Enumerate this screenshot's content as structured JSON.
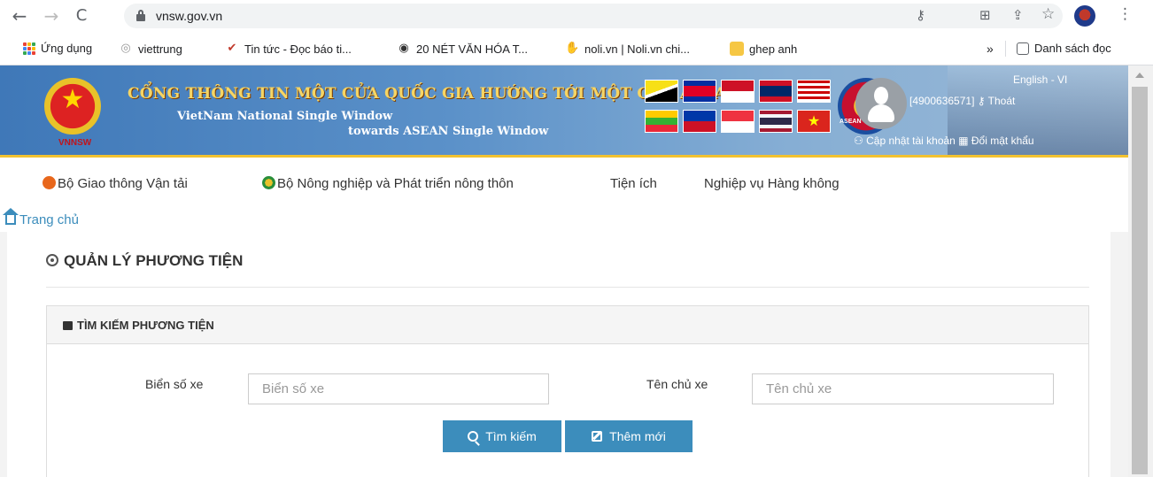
{
  "browser": {
    "url": "vnsw.gov.vn",
    "back_icon": "←",
    "forward_icon": "→",
    "reload_icon": "C",
    "star_icon": "☆",
    "menu_icon": "⋮",
    "key_icon": "⚷",
    "share_icon": "⇪",
    "translate_icon": "⊞"
  },
  "bookmarks": {
    "items": [
      {
        "label": "Ứng dụng",
        "icon": "apps-grid"
      },
      {
        "label": "viettrung",
        "icon": "globe-icon"
      },
      {
        "label": "Tin tức - Đọc báo ti...",
        "icon": "check-icon"
      },
      {
        "label": "20 NÉT VĂN HÓA T...",
        "icon": "globe-icon"
      },
      {
        "label": "noli.vn | Noli.vn chi...",
        "icon": "hand-icon"
      },
      {
        "label": "ghep anh",
        "icon": "folder-icon"
      }
    ],
    "overflow": "»",
    "reading_list": "Danh sách đọc"
  },
  "banner": {
    "emblem_label": "VNNSW",
    "title": "CỔNG THÔNG TIN MỘT CỬA QUỐC GIA HƯỚNG TỚI MỘT CỬA ASEAN",
    "subtitle1": "VietNam National Single Window",
    "subtitle2": "towards ASEAN Single Window",
    "asean_label": "ASEAN",
    "language": "English - VI",
    "account": "[4900636571]",
    "logout": "Thoát",
    "update_account": "Cập nhật tài khoản",
    "change_password": "Đổi mật khẩu"
  },
  "menu": {
    "items": [
      {
        "label": "Bộ Giao thông Vận tải"
      },
      {
        "label": "Bộ Nông nghiệp và Phát triển nông thôn"
      },
      {
        "label": "Tiện ích"
      },
      {
        "label": "Nghiệp vụ Hàng không"
      }
    ]
  },
  "breadcrumb": {
    "home": "Trang chủ"
  },
  "page": {
    "title": "QUẢN LÝ PHƯƠNG TIỆN"
  },
  "search": {
    "title": "TÌM KIẾM PHƯƠNG TIỆN",
    "plate_label": "Biển số xe",
    "plate_placeholder": "Biển số xe",
    "owner_label": "Tên chủ xe",
    "owner_placeholder": "Tên chủ xe",
    "search_button": "Tìm kiếm",
    "add_button": "Thêm mới"
  },
  "colors": {
    "accent": "#3c8dbc",
    "banner_blue": "#3f78b8",
    "banner_border": "#f2c230",
    "title_gold": "#f6d564"
  }
}
